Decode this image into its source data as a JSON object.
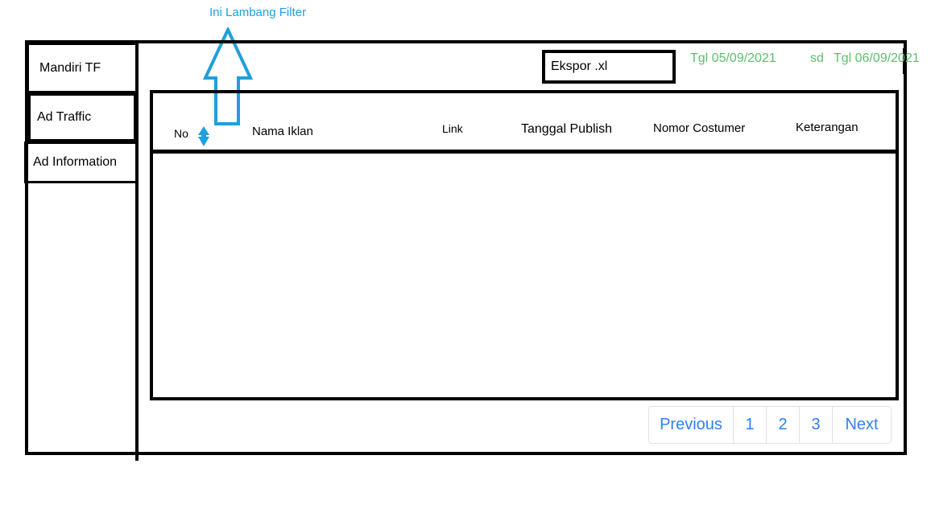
{
  "annotation": {
    "label": "Ini Lambang Filter"
  },
  "sidebar": {
    "items": [
      {
        "label": "Mandiri TF"
      },
      {
        "label": "Ad Traffic"
      },
      {
        "label": "Ad Information"
      }
    ]
  },
  "toolbar": {
    "export_label": "Ekspor .xl",
    "date_start": "Tgl 05/09/2021",
    "date_separator": "sd",
    "date_end": "Tgl 06/09/2021"
  },
  "table": {
    "columns": [
      "No",
      "Nama Iklan",
      "Link",
      "Tanggal Publish",
      "Nomor Costumer",
      "Keterangan"
    ],
    "rows": []
  },
  "pagination": {
    "previous": "Previous",
    "pages": [
      "1",
      "2",
      "3"
    ],
    "next": "Next"
  },
  "colors": {
    "annotation": "#1ea0dc",
    "date_text": "#5cbf6a",
    "link": "#2f7ff4",
    "border": "#000000"
  },
  "icons": {
    "filter": "sort-filter-icon",
    "annotation_arrow": "arrow-up-icon"
  }
}
